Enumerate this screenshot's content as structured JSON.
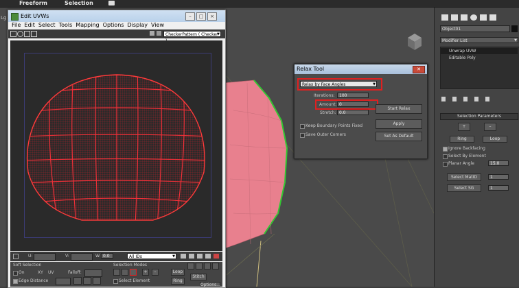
{
  "topbar": {
    "freeform": "Freeform",
    "selection": "Selection"
  },
  "viewport": {
    "corner_label": "Lg"
  },
  "uvw_window": {
    "title": "Edit UVWs",
    "menu": [
      "File",
      "Edit",
      "Select",
      "Tools",
      "Mapping",
      "Options",
      "Display",
      "View"
    ],
    "texture_dropdown": "CheckerPattern  ( Checker )",
    "bottom": {
      "u_label": "U:",
      "v_label": "V:",
      "w_label": "W:",
      "w_value": "0.0",
      "ids_dropdown": "All IDs",
      "soft_selection_title": "Soft Selection",
      "on_label": "On",
      "xy_label": "XY",
      "uv_label": "UV",
      "falloff_label": "Falloff:",
      "edge_distance_label": "Edge Distance",
      "selection_modes_title": "Selection Modes",
      "select_element_label": "Select Element",
      "loop_label": "Loop",
      "ring_label": "Ring",
      "stitch_label": "Stitch",
      "options_label": "Options..."
    }
  },
  "relax_tool": {
    "title": "Relax Tool",
    "method": "Relax by Face Angles",
    "iterations_label": "Iterations:",
    "iterations_value": "100",
    "amount_label": "Amount:",
    "amount_value": "0",
    "stretch_label": "Stretch:",
    "stretch_value": "0.0",
    "keep_boundary_label": "Keep Boundary Points Fixed",
    "save_outer_label": "Save Outer Corners",
    "start_button": "Start Relax",
    "apply_button": "Apply",
    "default_button": "Set As Default"
  },
  "command_panel": {
    "object_name": "Object01",
    "modifier_list": "Modifier List",
    "stack": [
      "Unwrap UVW",
      "Editable Poly"
    ],
    "selection_params_title": "Selection Parameters",
    "ring_button": "Ring",
    "loop_button": "Loop",
    "ignore_backfacing": "Ignore Backfacing",
    "select_by_element": "Select By Element",
    "planar_angle_label": "Planar Angle",
    "planar_angle_value": "15.0",
    "select_matid_button": "Select MatID",
    "matid_value": "1",
    "select_sg_button": "Select SG",
    "sg_value": "1"
  },
  "colors": {
    "mesh_wire": "#e8252c",
    "mesh_fill": "#e8808e",
    "selected_edge": "#32c832",
    "highlight_box": "#e02020"
  }
}
